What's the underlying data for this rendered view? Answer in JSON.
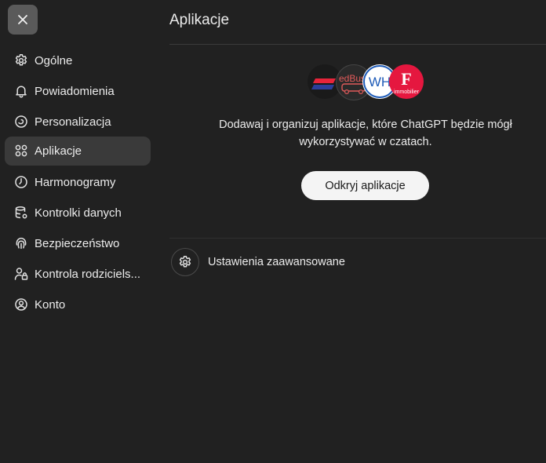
{
  "sidebar": {
    "items": [
      {
        "label": "Ogólne",
        "icon": "gear-icon",
        "active": false
      },
      {
        "label": "Powiadomienia",
        "icon": "bell-icon",
        "active": false
      },
      {
        "label": "Personalizacja",
        "icon": "personalization-icon",
        "active": false
      },
      {
        "label": "Aplikacje",
        "icon": "apps-grid-icon",
        "active": true
      },
      {
        "label": "Harmonogramy",
        "icon": "clock-icon",
        "active": false
      },
      {
        "label": "Kontrolki danych",
        "icon": "database-icon",
        "active": false
      },
      {
        "label": "Bezpieczeństwo",
        "icon": "fingerprint-icon",
        "active": false
      },
      {
        "label": "Kontrola rodziciels...",
        "icon": "parental-lock-icon",
        "active": false
      },
      {
        "label": "Konto",
        "icon": "account-icon",
        "active": false
      }
    ]
  },
  "main": {
    "title": "Aplikacje",
    "description_line1": "Dodawaj i organizuj aplikacje, które ChatGPT będzie mógł",
    "description_line2": "wykorzystywać w czatach.",
    "discover_button": "Odkryj aplikacje",
    "advanced_settings": "Ustawienia zaawansowane",
    "app_logos": [
      {
        "icon": "app-logo-stripes-icon",
        "color": "#1a1a1a"
      },
      {
        "icon": "redbus-logo-icon",
        "color": "#2a2a2a",
        "text": "edBus"
      },
      {
        "icon": "wh-logo-icon",
        "color": "#ffffff",
        "text": "WH"
      },
      {
        "icon": "immobilier-logo-icon",
        "color": "#e5173f",
        "text": "F",
        "subtext": "immobilier"
      }
    ]
  },
  "colors": {
    "background": "#212121",
    "active_item": "#3a3a3a",
    "button_bg": "#f4f4f4"
  }
}
